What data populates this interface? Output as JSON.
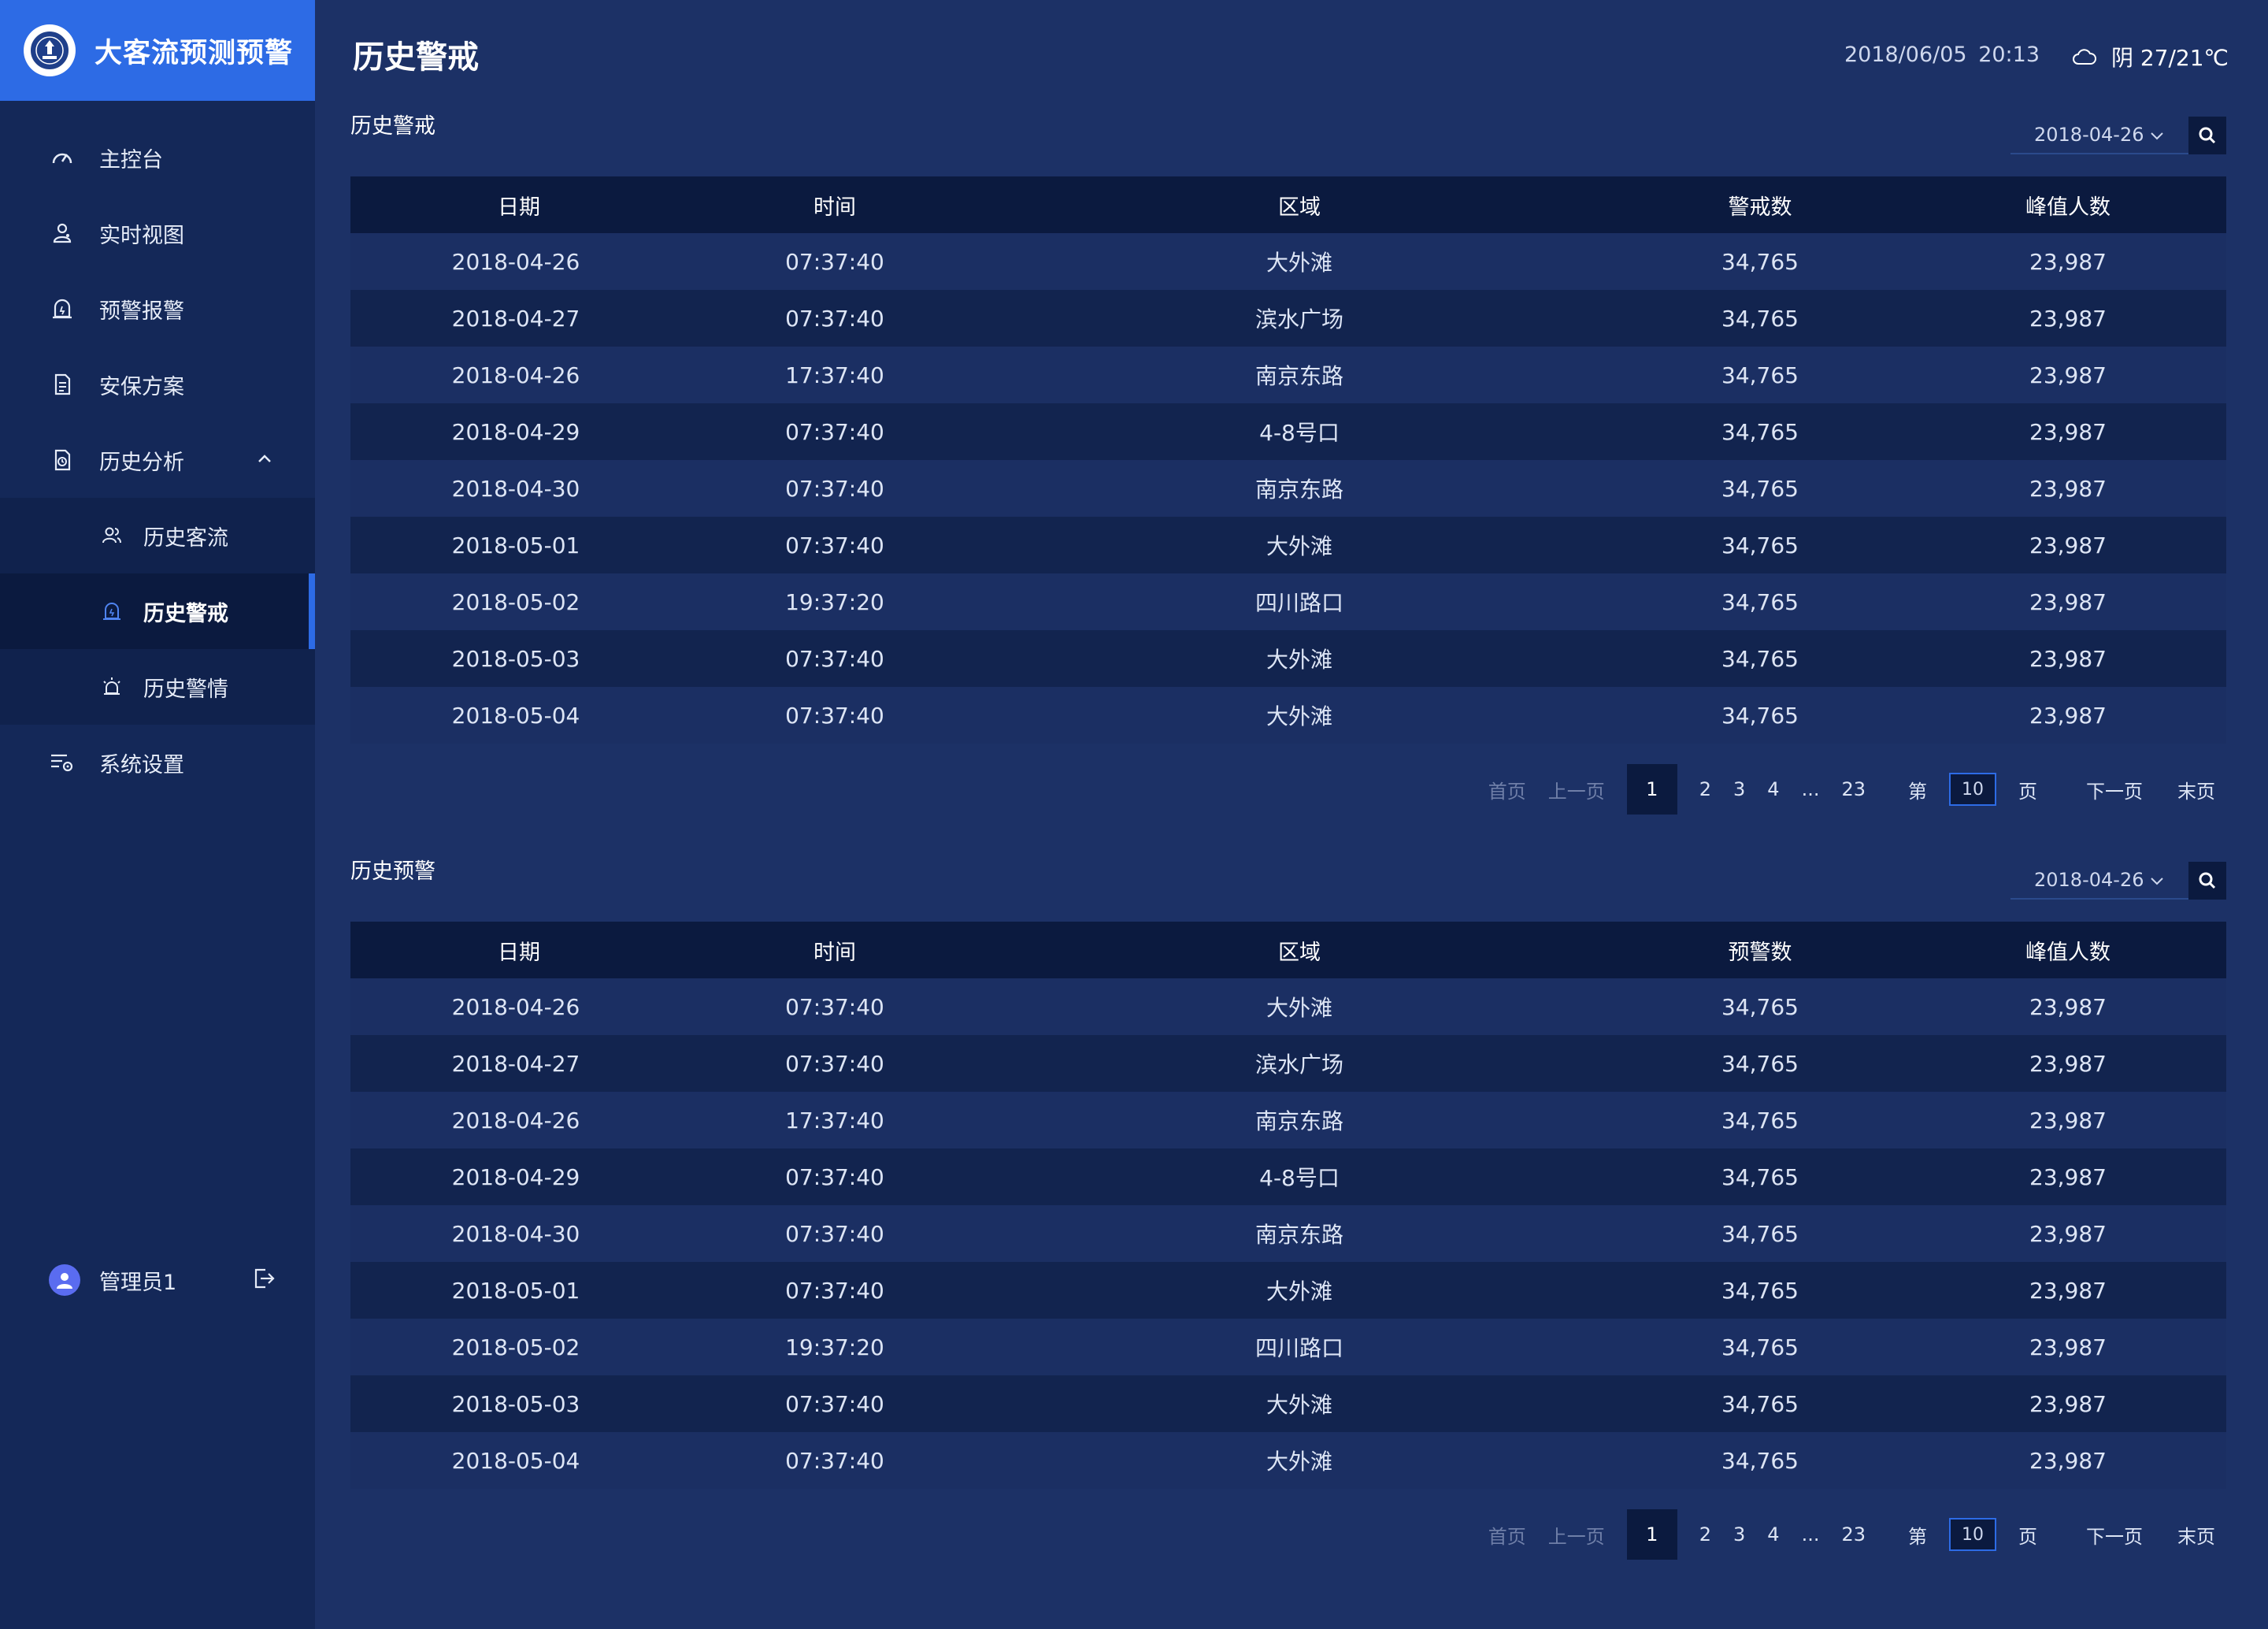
{
  "brand": {
    "title": "大客流预测预警"
  },
  "nav": [
    {
      "label": "主控台",
      "icon": "dashboard-icon"
    },
    {
      "label": "实时视图",
      "icon": "user-location-icon"
    },
    {
      "label": "预警报警",
      "icon": "alarm-icon"
    },
    {
      "label": "安保方案",
      "icon": "document-icon"
    },
    {
      "label": "历史分析",
      "icon": "history-doc-icon"
    }
  ],
  "subnav": [
    {
      "label": "历史客流",
      "icon": "users-icon"
    },
    {
      "label": "历史警戒",
      "icon": "alarm-icon"
    },
    {
      "label": "历史警情",
      "icon": "siren-icon"
    }
  ],
  "settings": {
    "label": "系统设置",
    "icon": "settings-list-icon"
  },
  "user": {
    "name": "管理员1"
  },
  "header": {
    "title": "历史警戒",
    "date": "2018/06/05",
    "time": "20:13",
    "weather": "阴 27/21℃"
  },
  "section1": {
    "title": "历史警戒",
    "filter_date": "2018-04-26",
    "columns": [
      "日期",
      "时间",
      "区域",
      "警戒数",
      "峰值人数"
    ],
    "rows": [
      [
        "2018-04-26",
        "07:37:40",
        "大外滩",
        "34,765",
        "23,987"
      ],
      [
        "2018-04-27",
        "07:37:40",
        "滨水广场",
        "34,765",
        "23,987"
      ],
      [
        "2018-04-26",
        "17:37:40",
        "南京东路",
        "34,765",
        "23,987"
      ],
      [
        "2018-04-29",
        "07:37:40",
        "4-8号口",
        "34,765",
        "23,987"
      ],
      [
        "2018-04-30",
        "07:37:40",
        "南京东路",
        "34,765",
        "23,987"
      ],
      [
        "2018-05-01",
        "07:37:40",
        "大外滩",
        "34,765",
        "23,987"
      ],
      [
        "2018-05-02",
        "19:37:20",
        "四川路口",
        "34,765",
        "23,987"
      ],
      [
        "2018-05-03",
        "07:37:40",
        "大外滩",
        "34,765",
        "23,987"
      ],
      [
        "2018-05-04",
        "07:37:40",
        "大外滩",
        "34,765",
        "23,987"
      ]
    ]
  },
  "section2": {
    "title": "历史预警",
    "filter_date": "2018-04-26",
    "columns": [
      "日期",
      "时间",
      "区域",
      "预警数",
      "峰值人数"
    ],
    "rows": [
      [
        "2018-04-26",
        "07:37:40",
        "大外滩",
        "34,765",
        "23,987"
      ],
      [
        "2018-04-27",
        "07:37:40",
        "滨水广场",
        "34,765",
        "23,987"
      ],
      [
        "2018-04-26",
        "17:37:40",
        "南京东路",
        "34,765",
        "23,987"
      ],
      [
        "2018-04-29",
        "07:37:40",
        "4-8号口",
        "34,765",
        "23,987"
      ],
      [
        "2018-04-30",
        "07:37:40",
        "南京东路",
        "34,765",
        "23,987"
      ],
      [
        "2018-05-01",
        "07:37:40",
        "大外滩",
        "34,765",
        "23,987"
      ],
      [
        "2018-05-02",
        "19:37:20",
        "四川路口",
        "34,765",
        "23,987"
      ],
      [
        "2018-05-03",
        "07:37:40",
        "大外滩",
        "34,765",
        "23,987"
      ],
      [
        "2018-05-04",
        "07:37:40",
        "大外滩",
        "34,765",
        "23,987"
      ]
    ]
  },
  "pager": {
    "first": "首页",
    "prev": "上一页",
    "pages": [
      "1",
      "2",
      "3",
      "4",
      "...",
      "23"
    ],
    "current": "1",
    "goto_prefix": "第",
    "goto_value": "10",
    "goto_suffix": "页",
    "next": "下一页",
    "last": "末页"
  },
  "colors": {
    "accent": "#2d6be5",
    "background": "#1c3166",
    "sidebar": "#142858",
    "header_row": "#0b1a3f"
  }
}
